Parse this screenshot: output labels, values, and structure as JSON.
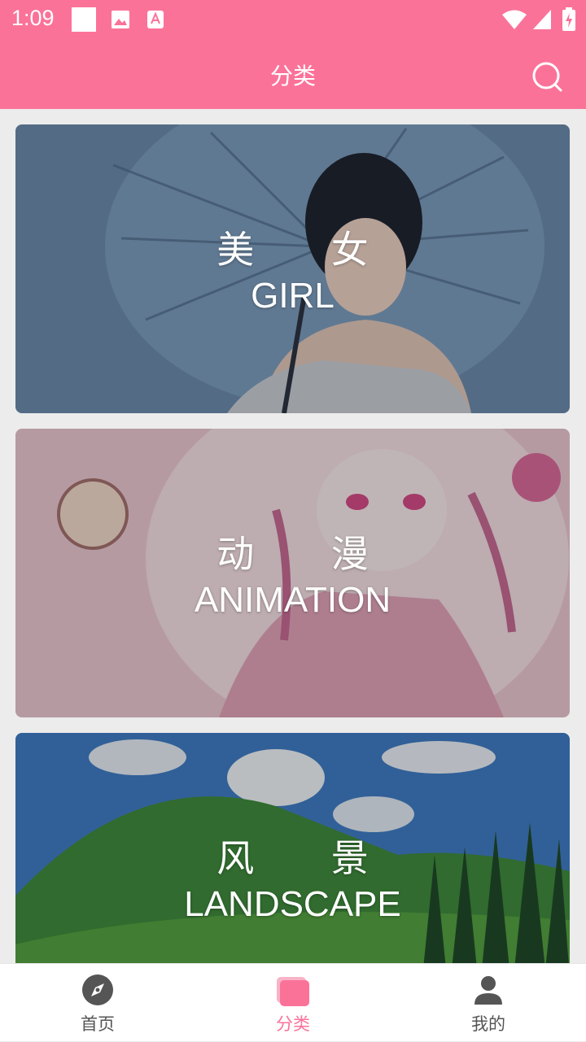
{
  "status_bar": {
    "time": "1:09"
  },
  "header": {
    "title": "分类",
    "search_icon": "search-icon"
  },
  "categories": [
    {
      "cn": "美 女",
      "en": "GIRL"
    },
    {
      "cn": "动 漫",
      "en": "ANIMATION"
    },
    {
      "cn": "风 景",
      "en": "LANDSCAPE"
    }
  ],
  "bottom_nav": [
    {
      "label": "首页",
      "icon": "compass-icon",
      "active": false
    },
    {
      "label": "分类",
      "icon": "category-icon",
      "active": true
    },
    {
      "label": "我的",
      "icon": "user-icon",
      "active": false
    }
  ],
  "colors": {
    "accent": "#fb7299",
    "nav_inactive": "#555555"
  }
}
